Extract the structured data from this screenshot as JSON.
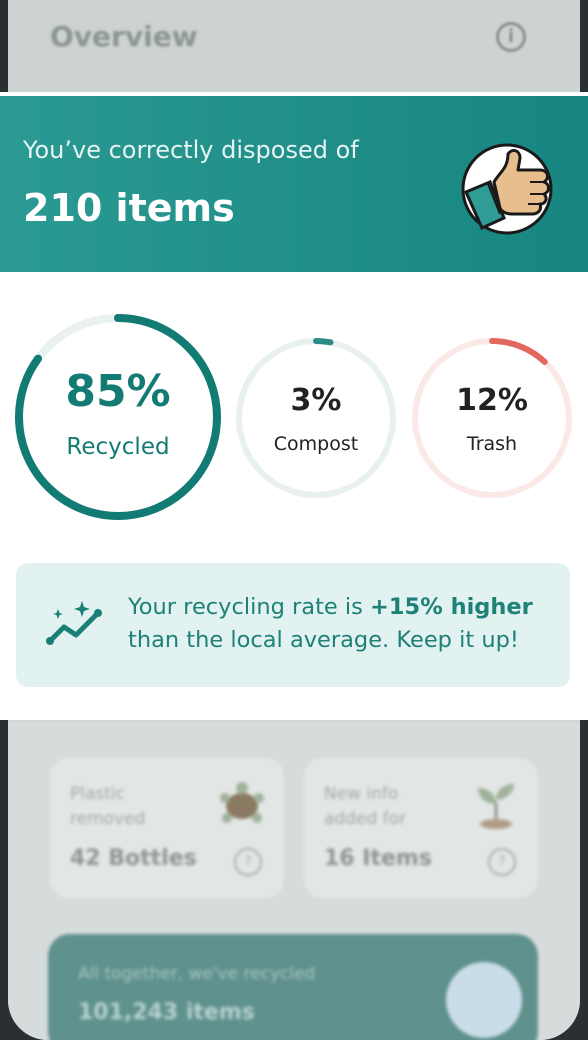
{
  "background": {
    "title": "Overview",
    "info_icon": "info-icon",
    "cards": [
      {
        "label_line1": "Plastic",
        "label_line2": "removed",
        "value": "42 Bottles",
        "icon": "turtle-icon"
      },
      {
        "label_line1": "New info",
        "label_line2": "added for",
        "value": "16 Items",
        "icon": "sprout-icon"
      }
    ],
    "banner": {
      "line1": "All together, we've recycled",
      "line2": "101,243 items",
      "icon": "globe-icon"
    }
  },
  "modal": {
    "subtitle": "You’ve correctly disposed of",
    "total": "210 items",
    "thumb_icon": "thumbs-up-icon",
    "stats": [
      {
        "pct": "85%",
        "label": "Recycled",
        "fraction": 0.85,
        "color": "#127b74",
        "track": "#e9f2f1"
      },
      {
        "pct": "3%",
        "label": "Compost",
        "fraction": 0.03,
        "color": "#2b8c86",
        "track": "#e8f1f0"
      },
      {
        "pct": "12%",
        "label": "Trash",
        "fraction": 0.12,
        "color": "#e2685f",
        "track": "#fbe9e7"
      }
    ],
    "tip": {
      "pre": "Your recycling rate is ",
      "highlight": "+15% higher",
      "post": " than the local average. Keep it up!",
      "icon": "sparkle-trend-icon"
    }
  }
}
